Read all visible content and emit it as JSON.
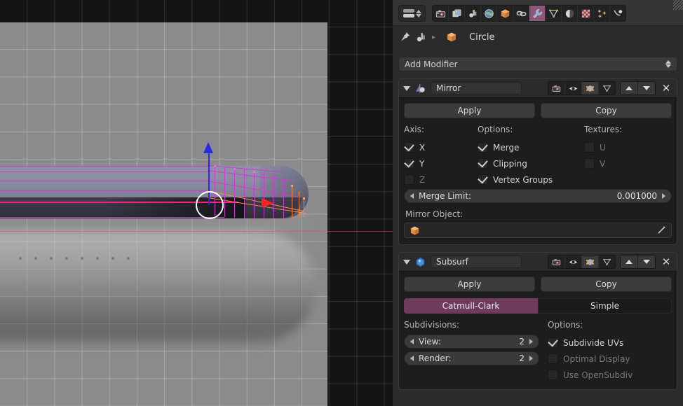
{
  "viewport": {
    "name": "3d-viewport",
    "object_mode": "Edit Mode",
    "manipulator": {
      "z_axis_color": "#2a2ae0",
      "x_axis_color": "#ff2020",
      "circle_color": "#ffffff"
    },
    "mesh_wire_color": "#cf3ad0",
    "mesh_selected_color": "#ff8a3c",
    "grid_color": "#afafaf"
  },
  "properties": {
    "editor_type": "properties-editor",
    "tabs": [
      {
        "name": "render",
        "icon": "camera-icon",
        "active": false
      },
      {
        "name": "render-layers",
        "icon": "layers-icon",
        "active": false
      },
      {
        "name": "scene",
        "icon": "scene-icon",
        "active": false
      },
      {
        "name": "world",
        "icon": "world-icon",
        "active": false
      },
      {
        "name": "object",
        "icon": "cube-icon",
        "active": false
      },
      {
        "name": "constraints",
        "icon": "chain-icon",
        "active": false
      },
      {
        "name": "modifiers",
        "icon": "wrench-icon",
        "active": true
      },
      {
        "name": "object-data",
        "icon": "triangle-mesh-icon",
        "active": false
      },
      {
        "name": "material",
        "icon": "sphere-icon",
        "active": false
      },
      {
        "name": "texture",
        "icon": "checker-icon",
        "active": false
      },
      {
        "name": "particles",
        "icon": "particles-icon",
        "active": false
      },
      {
        "name": "physics",
        "icon": "physics-icon",
        "active": false
      }
    ],
    "breadcrumb": {
      "pin_icon": "pin-icon",
      "data_icon": "object-data-icon",
      "separator": "▸",
      "object_icon": "mesh-cube-icon",
      "object_name": "Circle"
    },
    "add_modifier": {
      "label": "Add Modifier"
    },
    "modifiers": [
      {
        "id": "mirror",
        "icon": "mirror-modifier-icon",
        "name": "Mirror",
        "header_toggles": [
          {
            "name": "render-toggle",
            "icon": "camera-icon",
            "on": false
          },
          {
            "name": "realtime-toggle",
            "icon": "eye-icon",
            "on": false
          },
          {
            "name": "edit-mode-toggle",
            "icon": "edit-mode-icon",
            "on": true
          },
          {
            "name": "on-cage-toggle",
            "icon": "cage-icon",
            "on": false
          }
        ],
        "move_up_label": "▲",
        "move_down_label": "▼",
        "close_label": "✕",
        "apply_label": "Apply",
        "copy_label": "Copy",
        "groups": {
          "axis_label": "Axis:",
          "axis": [
            {
              "label": "X",
              "checked": true,
              "enabled": true
            },
            {
              "label": "Y",
              "checked": true,
              "enabled": true
            },
            {
              "label": "Z",
              "checked": false,
              "enabled": false
            }
          ],
          "options_label": "Options:",
          "options": [
            {
              "label": "Merge",
              "checked": true,
              "enabled": true
            },
            {
              "label": "Clipping",
              "checked": true,
              "enabled": true
            },
            {
              "label": "Vertex Groups",
              "checked": true,
              "enabled": true
            }
          ],
          "textures_label": "Textures:",
          "textures": [
            {
              "label": "U",
              "checked": false,
              "enabled": false
            },
            {
              "label": "V",
              "checked": false,
              "enabled": false
            }
          ]
        },
        "merge_limit": {
          "label": "Merge Limit:",
          "value": "0.001000"
        },
        "mirror_object": {
          "label": "Mirror Object:",
          "value": "",
          "icon": "mesh-cube-icon",
          "dropper_icon": "eyedropper-icon"
        }
      },
      {
        "id": "subsurf",
        "icon": "subsurf-modifier-icon",
        "name": "Subsurf",
        "header_toggles": [
          {
            "name": "render-toggle",
            "icon": "camera-icon",
            "on": false
          },
          {
            "name": "realtime-toggle",
            "icon": "eye-icon",
            "on": false
          },
          {
            "name": "edit-mode-toggle",
            "icon": "edit-mode-icon",
            "on": true
          },
          {
            "name": "on-cage-toggle",
            "icon": "cage-icon",
            "on": false
          }
        ],
        "move_up_label": "▲",
        "move_down_label": "▼",
        "close_label": "✕",
        "apply_label": "Apply",
        "copy_label": "Copy",
        "subdiv_type": [
          {
            "label": "Catmull-Clark",
            "active": true
          },
          {
            "label": "Simple",
            "active": false
          }
        ],
        "subdivisions_label": "Subdivisions:",
        "view": {
          "label": "View:",
          "value": "2"
        },
        "render": {
          "label": "Render:",
          "value": "2"
        },
        "options_label": "Options:",
        "options": [
          {
            "label": "Subdivide UVs",
            "checked": true,
            "enabled": true
          },
          {
            "label": "Optimal Display",
            "checked": false,
            "enabled": false
          },
          {
            "label": "Use OpenSubdiv",
            "checked": false,
            "enabled": false
          }
        ]
      }
    ]
  },
  "colors": {
    "accent_active": "#6e3b5c",
    "tab_active": "#8d5878",
    "panel_bg": "#1d1d1d",
    "editor_bg": "#2b2b2b",
    "header_bg": "#343434"
  }
}
